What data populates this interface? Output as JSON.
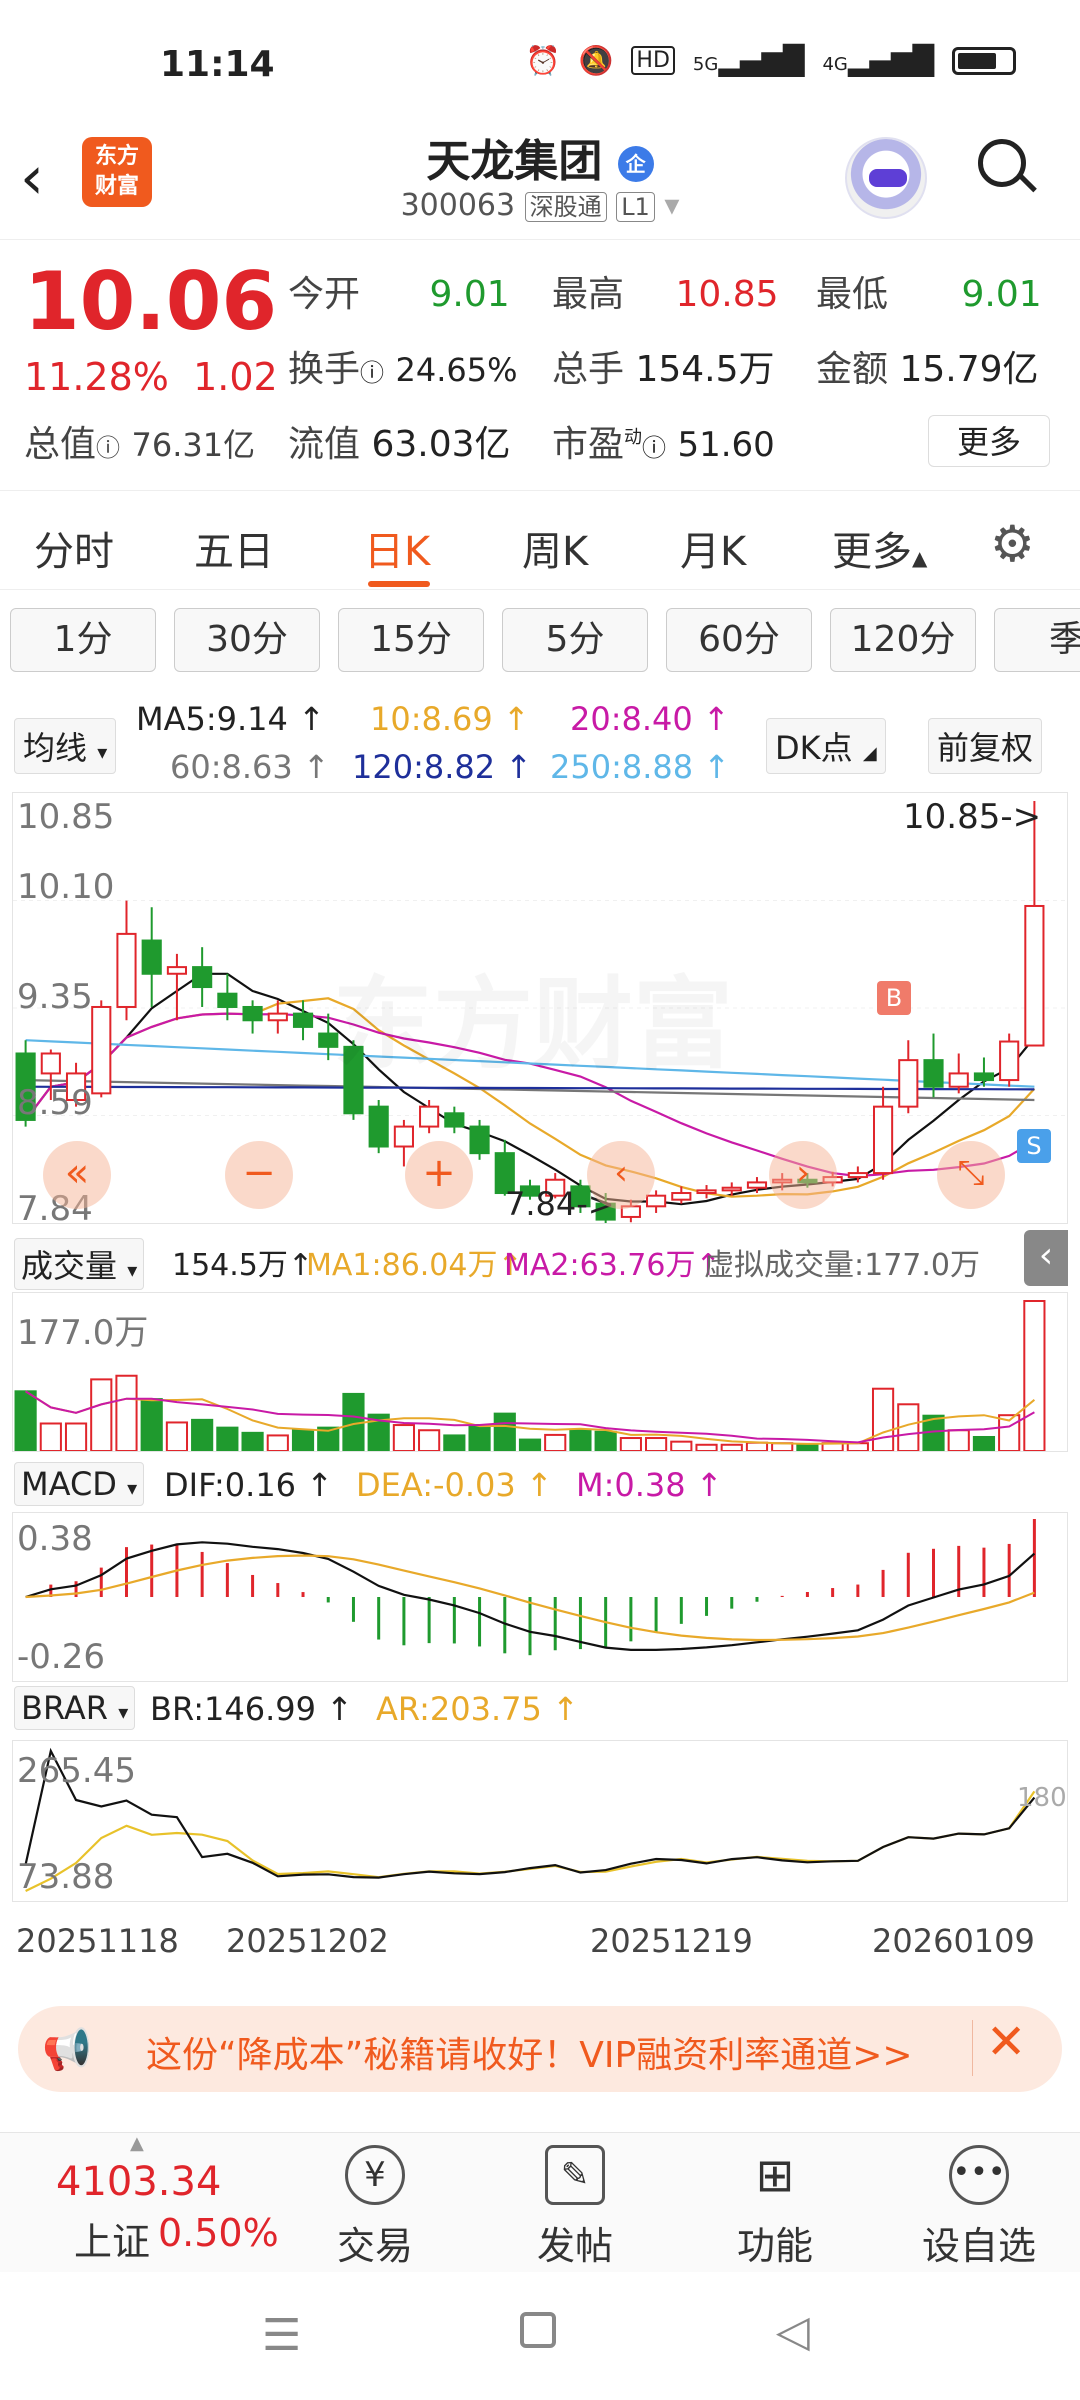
{
  "status": {
    "time": "11:14",
    "hd": "HD",
    "net1": "5G",
    "net2": "4G"
  },
  "header": {
    "logo_line1": "东方",
    "logo_line2": "财富",
    "name": "天龙集团",
    "code": "300063",
    "market": "深股通",
    "level": "L1",
    "badge": "企"
  },
  "quote": {
    "price": "10.06",
    "pct": "11.28%",
    "change": "1.02",
    "open_label": "今开",
    "open": "9.01",
    "high_label": "最高",
    "high": "10.85",
    "low_label": "最低",
    "low": "9.01",
    "turnover_label": "换手",
    "turnover": "24.65%",
    "volume_label": "总手",
    "volume": "154.5万",
    "amount_label": "金额",
    "amount": "15.79亿",
    "mcap_label": "总值",
    "mcap": "76.31亿",
    "float_label": "流值",
    "float": "63.03亿",
    "pe_label": "市盈",
    "pe_sup": "动",
    "pe": "51.60",
    "more": "更多"
  },
  "tabs": [
    "分时",
    "五日",
    "日K",
    "周K",
    "月K",
    "更多"
  ],
  "minute_buttons": [
    "1分",
    "30分",
    "15分",
    "5分",
    "60分",
    "120分",
    "季"
  ],
  "ma": {
    "selector": "均线",
    "ma5": "MA5:9.14",
    "ma10": "10:8.69",
    "ma20": "20:8.40",
    "ma60": "60:8.63",
    "ma120": "120:8.82",
    "ma250": "250:8.88",
    "dk": "DK点",
    "adjust": "前复权"
  },
  "kline": {
    "ylabels": [
      "10.85",
      "10.10",
      "9.35",
      "8.59",
      "7.84"
    ],
    "high_marker": "10.85->",
    "low_marker": "7.84->",
    "watermark": "东方财富",
    "b_label": "B",
    "s_label": "S"
  },
  "volume_ind": {
    "selector": "成交量",
    "value": "154.5万",
    "ma1": "MA1:86.04万",
    "ma2": "MA2:63.76万",
    "virtual": "虚拟成交量:177.0万",
    "ymax": "177.0万"
  },
  "macd": {
    "selector": "MACD",
    "dif": "DIF:0.16",
    "dea": "DEA:-0.03",
    "m": "M:0.38",
    "ymax": "0.38",
    "ymin": "-0.26"
  },
  "brar": {
    "selector": "BRAR",
    "br": "BR:146.99",
    "ar": "AR:203.75",
    "ymax": "265.45",
    "ymin": "73.88",
    "right": "180"
  },
  "dates": [
    "20251118",
    "20251202",
    "20251219",
    "20260109"
  ],
  "promo": {
    "text": "这份“降成本”秘籍请收好！VIP融资利率通道>>"
  },
  "bottom": {
    "index_value": "4103.34",
    "index_name": "上证",
    "index_pct": "0.50%",
    "items": [
      "交易",
      "发帖",
      "功能",
      "设自选"
    ]
  },
  "chart_data": {
    "type": "candlestick",
    "ylim": [
      7.84,
      10.85
    ],
    "candles": [
      [
        8.95,
        8.45,
        9.05,
        8.4
      ],
      [
        8.8,
        8.95,
        8.98,
        8.6
      ],
      [
        8.6,
        8.8,
        8.88,
        8.55
      ],
      [
        8.65,
        9.3,
        9.35,
        8.62
      ],
      [
        9.3,
        9.85,
        10.1,
        9.2
      ],
      [
        9.8,
        9.55,
        10.05,
        9.3
      ],
      [
        9.55,
        9.6,
        9.7,
        9.2
      ],
      [
        9.6,
        9.45,
        9.75,
        9.3
      ],
      [
        9.4,
        9.3,
        9.55,
        9.2
      ],
      [
        9.3,
        9.2,
        9.35,
        9.1
      ],
      [
        9.2,
        9.25,
        9.35,
        9.1
      ],
      [
        9.25,
        9.15,
        9.35,
        9.05
      ],
      [
        9.1,
        9.0,
        9.25,
        8.9
      ],
      [
        9.0,
        8.5,
        9.05,
        8.45
      ],
      [
        8.55,
        8.25,
        8.6,
        8.2
      ],
      [
        8.25,
        8.4,
        8.45,
        8.1
      ],
      [
        8.4,
        8.55,
        8.6,
        8.35
      ],
      [
        8.5,
        8.4,
        8.55,
        8.35
      ],
      [
        8.4,
        8.2,
        8.45,
        8.15
      ],
      [
        8.2,
        7.9,
        8.3,
        7.88
      ],
      [
        7.95,
        7.88,
        8.0,
        7.85
      ],
      [
        7.88,
        8.0,
        8.05,
        7.86
      ],
      [
        7.95,
        7.8,
        8.0,
        7.75
      ],
      [
        7.82,
        7.7,
        7.9,
        7.65
      ],
      [
        7.72,
        7.8,
        7.85,
        7.68
      ],
      [
        7.8,
        7.88,
        7.92,
        7.75
      ],
      [
        7.85,
        7.9,
        7.95,
        7.82
      ],
      [
        7.9,
        7.92,
        7.96,
        7.86
      ],
      [
        7.92,
        7.94,
        7.98,
        7.88
      ],
      [
        7.94,
        7.98,
        8.02,
        7.9
      ],
      [
        7.98,
        8.0,
        8.05,
        7.92
      ],
      [
        8.0,
        7.98,
        8.05,
        7.94
      ],
      [
        7.98,
        8.02,
        8.06,
        7.95
      ],
      [
        8.02,
        8.05,
        8.1,
        7.98
      ],
      [
        8.05,
        8.55,
        8.7,
        8.0
      ],
      [
        8.55,
        8.9,
        9.05,
        8.5
      ],
      [
        8.9,
        8.7,
        9.1,
        8.62
      ],
      [
        8.7,
        8.8,
        8.95,
        8.65
      ],
      [
        8.8,
        8.75,
        8.92,
        8.7
      ],
      [
        8.75,
        9.04,
        9.1,
        8.7
      ],
      [
        9.01,
        10.06,
        10.85,
        9.01
      ]
    ]
  }
}
